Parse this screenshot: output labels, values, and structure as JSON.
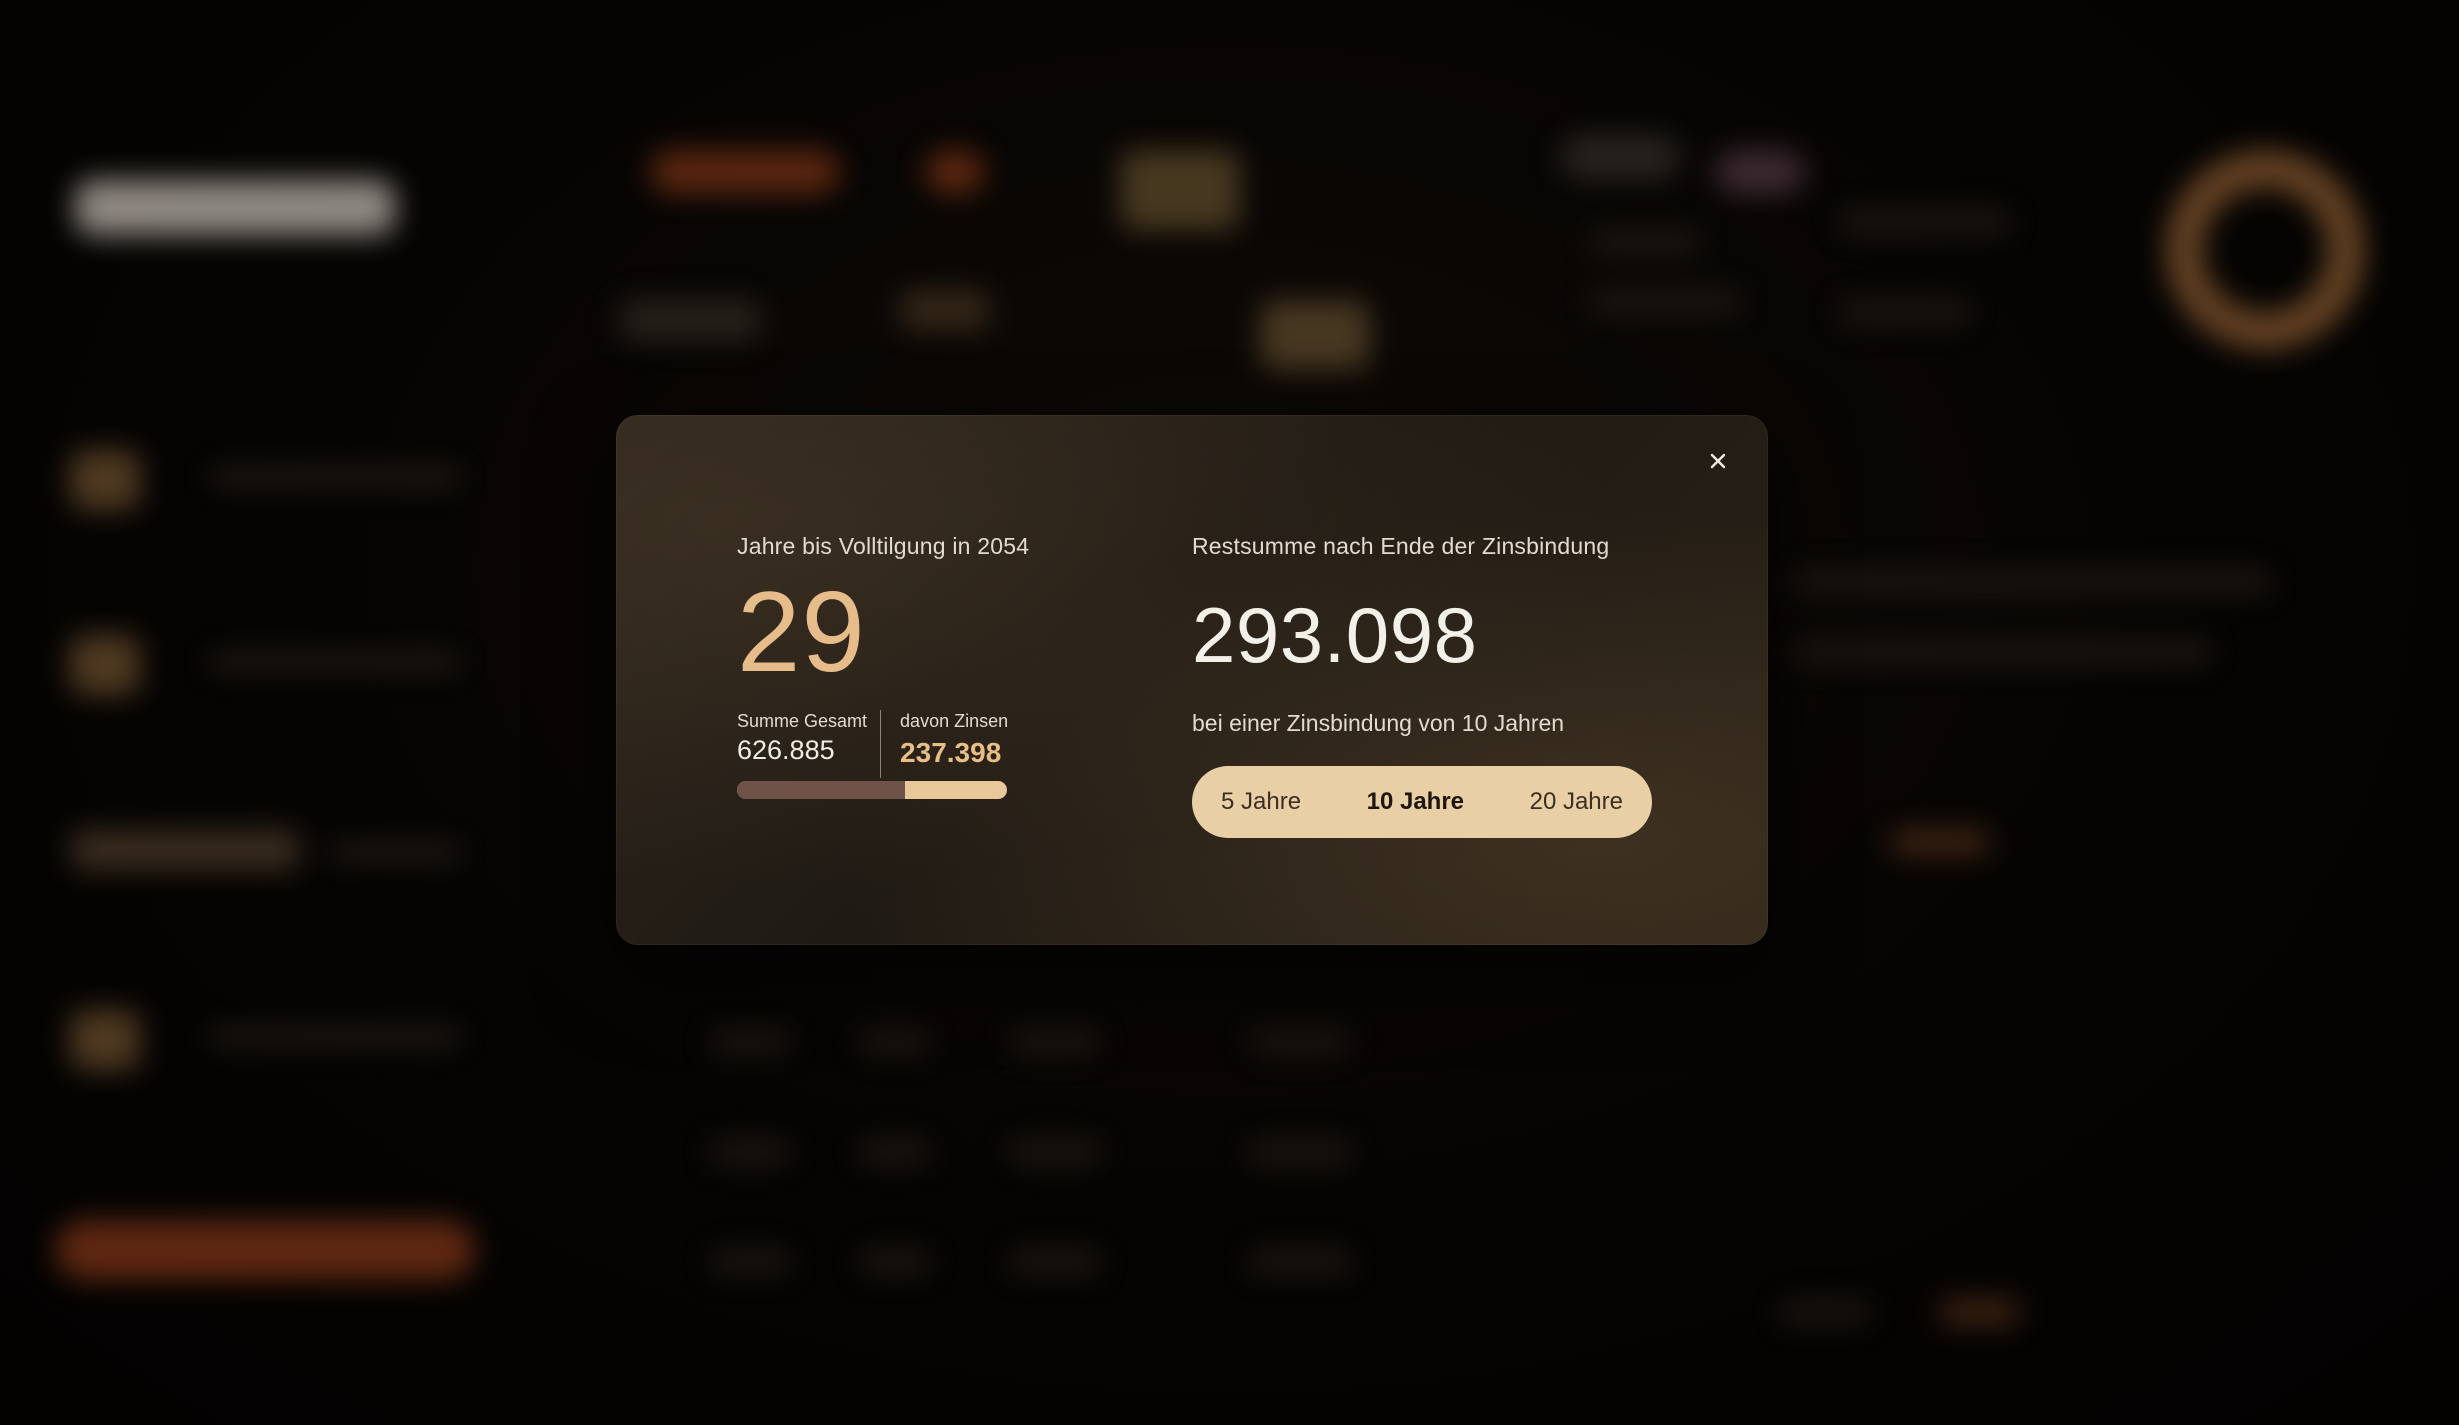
{
  "modal": {
    "close_icon": "close-icon",
    "left": {
      "label": "Jahre bis Volltilgung in 2054",
      "years": "29",
      "summe_label": "Summe Gesamt",
      "summe_value": "626.885",
      "zinsen_label": "davon Zinsen",
      "zinsen_value": "237.398",
      "principal_share": 0.621,
      "colors": {
        "principal": "#6f5248",
        "interest": "#e8c799"
      }
    },
    "right": {
      "label": "Restsumme nach Ende der Zinsbindung",
      "rest_value": "293.098",
      "sub_label": "bei einer Zinsbindung von 10 Jahren",
      "options": [
        {
          "label": "5 Jahre",
          "active": false
        },
        {
          "label": "10 Jahre",
          "active": true
        },
        {
          "label": "20 Jahre",
          "active": false
        }
      ]
    }
  },
  "colors": {
    "accent_gold": "#e6bd8a",
    "segmented_bg": "#e9cfa5",
    "modal_bg": "#241e17"
  }
}
